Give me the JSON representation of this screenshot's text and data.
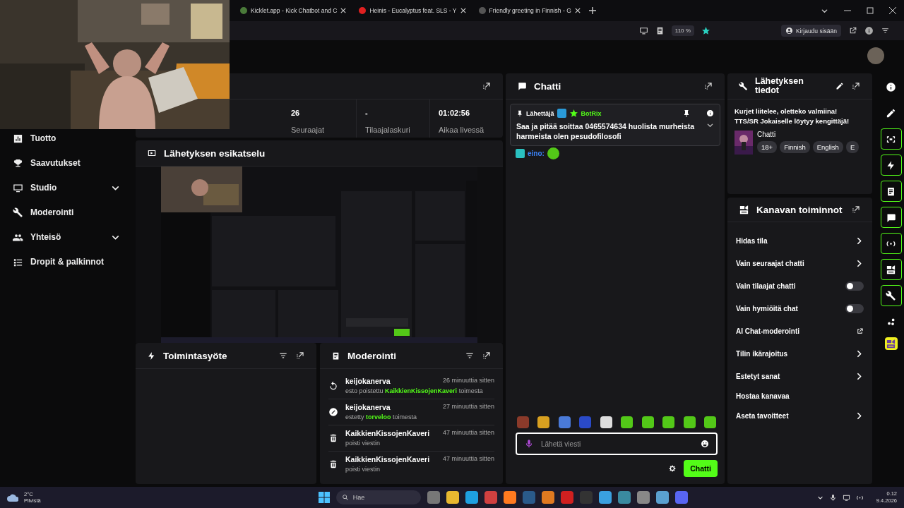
{
  "browser": {
    "tabs": [
      {
        "title": "Kicklet.app - Kick Chatbot and C"
      },
      {
        "title": "Heinis - Eucalyptus feat. SLS - Y"
      },
      {
        "title": "Friendly greeting in Finnish - G"
      }
    ],
    "zoom": "110 %",
    "sign_in": "Kirjaudu sisään"
  },
  "sidebar": {
    "items": [
      {
        "label": "Tuotto",
        "kind": "link"
      },
      {
        "label": "Saavutukset",
        "kind": "link"
      },
      {
        "label": "Studio",
        "kind": "group"
      },
      {
        "label": "Moderointi",
        "kind": "link"
      },
      {
        "label": "Yhteisö",
        "kind": "group"
      },
      {
        "label": "Dropit & palkinnot",
        "kind": "link"
      }
    ]
  },
  "stats": {
    "items": [
      {
        "value": "26",
        "label": "Seuraajat"
      },
      {
        "value": "-",
        "label": "Tilaajalaskuri"
      },
      {
        "value": "01:02:56",
        "label": "Aikaa livessä"
      }
    ]
  },
  "preview": {
    "title": "Lähetyksen esikatselu"
  },
  "activity": {
    "title": "Toimintasyöte"
  },
  "moderation": {
    "title": "Moderointi",
    "entries": [
      {
        "kind": "unban",
        "user": "keijokanerva",
        "time": "26 minuuttia sitten",
        "text": "esto poistettu",
        "target": "KaikkienKissojenKaveri",
        "suffix": "toimesta"
      },
      {
        "kind": "ban",
        "user": "keijokanerva",
        "time": "27 minuuttia sitten",
        "text": "estetty",
        "target": "torveloo",
        "suffix": "toimesta"
      },
      {
        "kind": "delete",
        "user": "KaikkienKissojenKaveri",
        "time": "47 minuuttia sitten",
        "text": "poisti viestin"
      },
      {
        "kind": "delete",
        "user": "KaikkienKissojenKaveri",
        "time": "47 minuuttia sitten",
        "text": "poisti viestin"
      }
    ]
  },
  "chat": {
    "title": "Chatti",
    "pinned": {
      "label": "Lähettäjä",
      "sender": "BotRix",
      "text": "Saa ja pitää soittaa 0465574634 huolista murheista harmeista olen pesudofilosofi"
    },
    "messages": [
      {
        "user": "eino:"
      }
    ],
    "placeholder": "Lähetä viesti",
    "send": "Chatti"
  },
  "stream_info": {
    "title": "Lähetyksen tiedot",
    "stream_title": [
      "Kurjet liitelee, oletteko valmiina!",
      "TTS/SR Jokaiselle löytyy kengittäjä!"
    ],
    "category": "Chatti",
    "tags": [
      "18+",
      "Finnish",
      "English",
      "E"
    ]
  },
  "channel_actions": {
    "title": "Kanavan toiminnot",
    "items": [
      {
        "label": "Hidas tila",
        "kind": "nav"
      },
      {
        "label": "Vain seuraajat chatti",
        "kind": "nav"
      },
      {
        "label": "Vain tilaajat chatti",
        "kind": "toggle",
        "on": false
      },
      {
        "label": "Vain hymiöitä chat",
        "kind": "toggle",
        "on": false
      },
      {
        "label": "AI Chat-moderointi",
        "kind": "external"
      },
      {
        "label": "Tilin ikärajoitus",
        "kind": "nav"
      },
      {
        "label": "Estetyt sanat",
        "kind": "nav"
      },
      {
        "label": "Hostaa kanavaa",
        "kind": "plain"
      },
      {
        "label": "Aseta tavoitteet",
        "kind": "nav"
      }
    ]
  },
  "rail": {
    "buttons": [
      {
        "kind": "tool",
        "active": false
      },
      {
        "kind": "tool",
        "active": false
      },
      {
        "kind": "tool",
        "active": true
      },
      {
        "kind": "tool",
        "active": true
      },
      {
        "kind": "tool",
        "active": true
      },
      {
        "kind": "tool",
        "active": true
      },
      {
        "kind": "tool",
        "active": true
      },
      {
        "kind": "tool",
        "active": true
      },
      {
        "kind": "tool",
        "active": true
      },
      {
        "kind": "tool",
        "active": false
      },
      {
        "kind": "app",
        "active": false
      }
    ]
  },
  "taskbar": {
    "temperature": "2°C",
    "weather": "Pilvistä",
    "search_placeholder": "Hae",
    "time": "0.12",
    "date": "9.4.2026"
  }
}
